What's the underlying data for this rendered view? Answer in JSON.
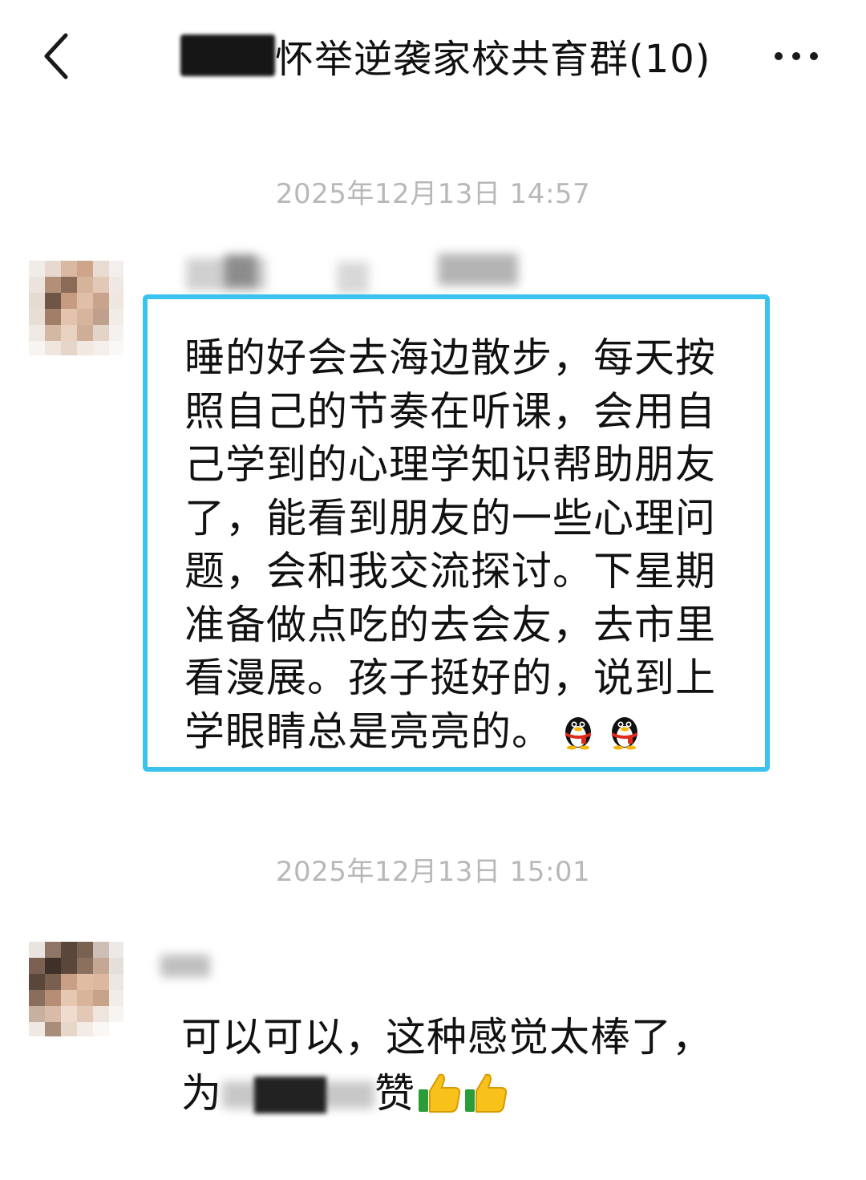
{
  "header": {
    "back_icon": "chevron-left-icon",
    "title": "怀举逆袭家校共育群(10)",
    "more_icon": "more-dots-icon"
  },
  "messages": [
    {
      "timestamp": "2025年12月13日 14:57",
      "text": "睡的好会去海边散步，每天按照自己的节奏在听课，会用自己学到的心理学知识帮助朋友了，能看到朋友的一些心理问题，会和我交流探讨。下星期准备做点吃的去会友，去市里看漫展。孩子挺好的，说到上学眼睛总是亮亮的。",
      "emoji": [
        "penguin-icon",
        "penguin-icon"
      ],
      "highlight_color": "#3cc2ef"
    },
    {
      "timestamp": "2025年12月13日 15:01",
      "line1": "可以可以，这种感觉太棒了，",
      "line2_prefix": "为",
      "line2_suffix": "赞",
      "emoji": [
        "thumbs-up-icon",
        "thumbs-up-icon"
      ]
    }
  ],
  "colors": {
    "timestamp": "#b8b8b8",
    "highlight_border": "#3cc2ef",
    "text": "#111111"
  }
}
